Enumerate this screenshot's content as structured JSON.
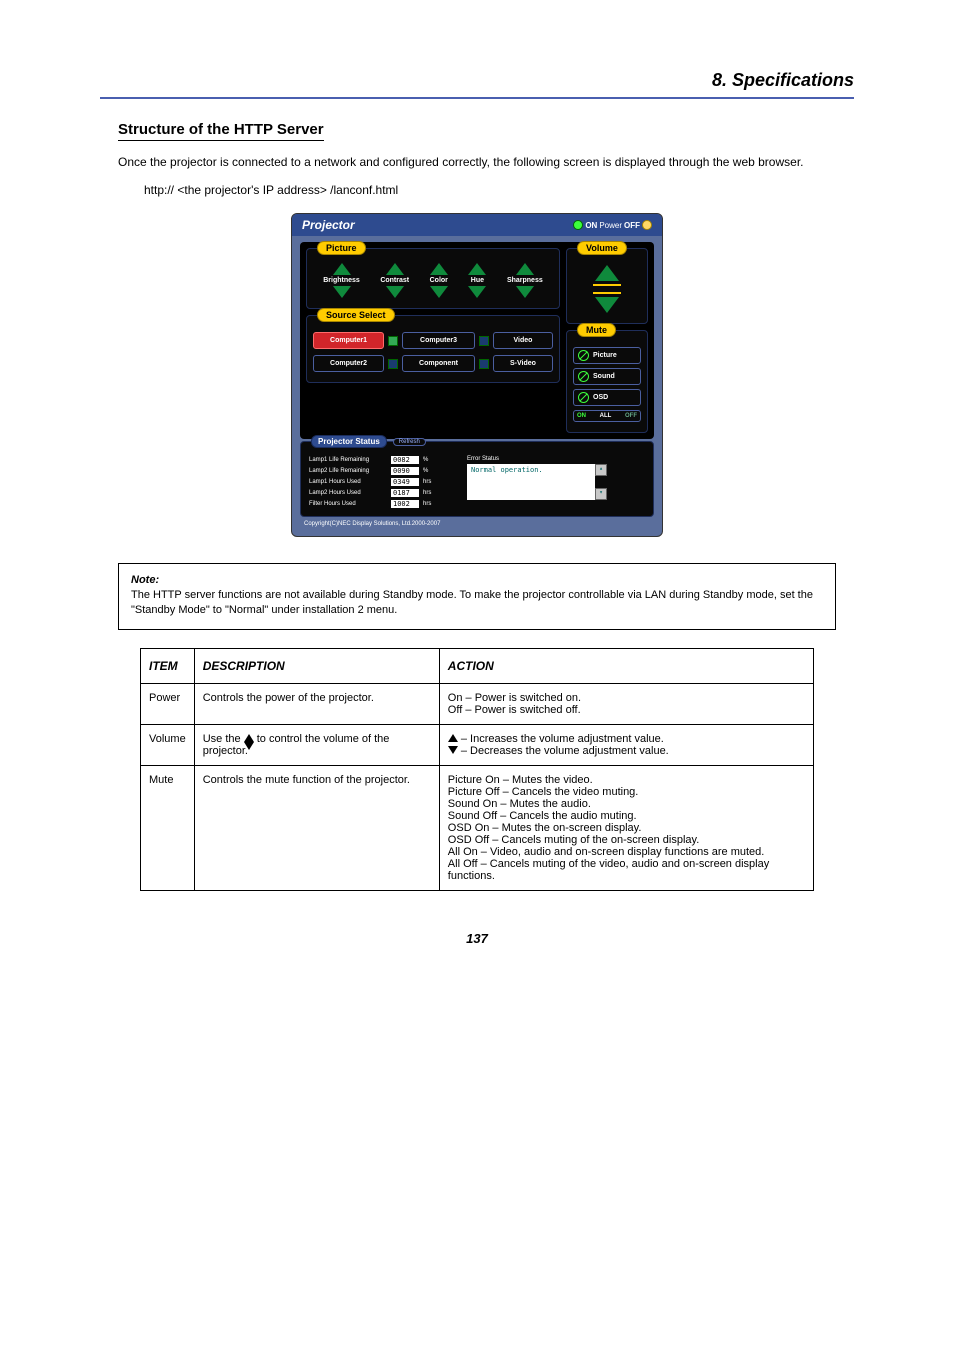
{
  "chapter": "8. Specifications",
  "section_title": "Structure of the HTTP Server",
  "intro_line1": "Once the projector is connected to a network and configured correctly, the following screen is displayed through the web browser.",
  "intro_line2": "http:// <the projector's IP address> /lanconf.html",
  "screenshot": {
    "title": "Projector",
    "header_on": "ON",
    "header_power": "Power",
    "header_off": "OFF",
    "picture_label": "Picture",
    "steppers": [
      "Brightness",
      "Contrast",
      "Color",
      "Hue",
      "Sharpness"
    ],
    "volume_label": "Volume",
    "source_label": "Source Select",
    "sources": [
      {
        "name": "Computer1",
        "active": true
      },
      {
        "name": "Computer3",
        "active": false
      },
      {
        "name": "Video",
        "active": false
      },
      {
        "name": "Computer2",
        "active": false
      },
      {
        "name": "Component",
        "active": false
      },
      {
        "name": "S-Video",
        "active": false
      }
    ],
    "mute_label": "Mute",
    "mute_items": [
      "Picture",
      "Sound",
      "OSD"
    ],
    "mute_all": [
      "ON",
      "ALL",
      "OFF"
    ],
    "status_label": "Projector Status",
    "refresh": "Refresh",
    "status_rows": [
      {
        "label": "Lamp1 Life Remaining",
        "val": "0082",
        "unit": "%"
      },
      {
        "label": "Lamp2 Life Remaining",
        "val": "0090",
        "unit": "%"
      },
      {
        "label": "Lamp1 Hours Used",
        "val": "0349",
        "unit": "hrs"
      },
      {
        "label": "Lamp2 Hours Used",
        "val": "0187",
        "unit": "hrs"
      },
      {
        "label": "Filter Hours Used",
        "val": "1002",
        "unit": "hrs"
      }
    ],
    "error_label": "Error Status",
    "error_text": "Normal operation.",
    "copyright": "Copyright(C)NEC Display Solutions, Ltd.2000-2007"
  },
  "note_label": "Note:",
  "note_body": "The HTTP server functions are not available during Standby mode. To make the projector controllable via LAN during Standby mode, set the \"Standby Mode\" to \"Normal\" under installation 2 menu.",
  "table": {
    "headers": [
      "ITEM",
      "DESCRIPTION",
      "ACTION"
    ],
    "rows": [
      {
        "item": "Power",
        "desc": "Controls the power of the projector.",
        "action": "On – Power is switched on.\nOff – Power is switched off."
      },
      {
        "item": "Volume",
        "desc": "Use the ▲▼ to control the volume of the projector.",
        "action": "▲ – Increases the volume adjustment value.\n▼ – Decreases the volume adjustment value."
      },
      {
        "item": "Mute",
        "desc": "Controls the mute function of the projector.",
        "action": "Picture On – Mutes the video.\nPicture Off – Cancels the video muting.\nSound On – Mutes the audio.\nSound Off – Cancels the audio muting.\nOSD On – Mutes the on-screen display.\nOSD Off – Cancels muting of the on-screen display.\nAll On – Video, audio and on-screen display functions are muted.\nAll Off – Cancels muting of the video, audio and on-screen display functions."
      }
    ]
  },
  "page_number": "137"
}
